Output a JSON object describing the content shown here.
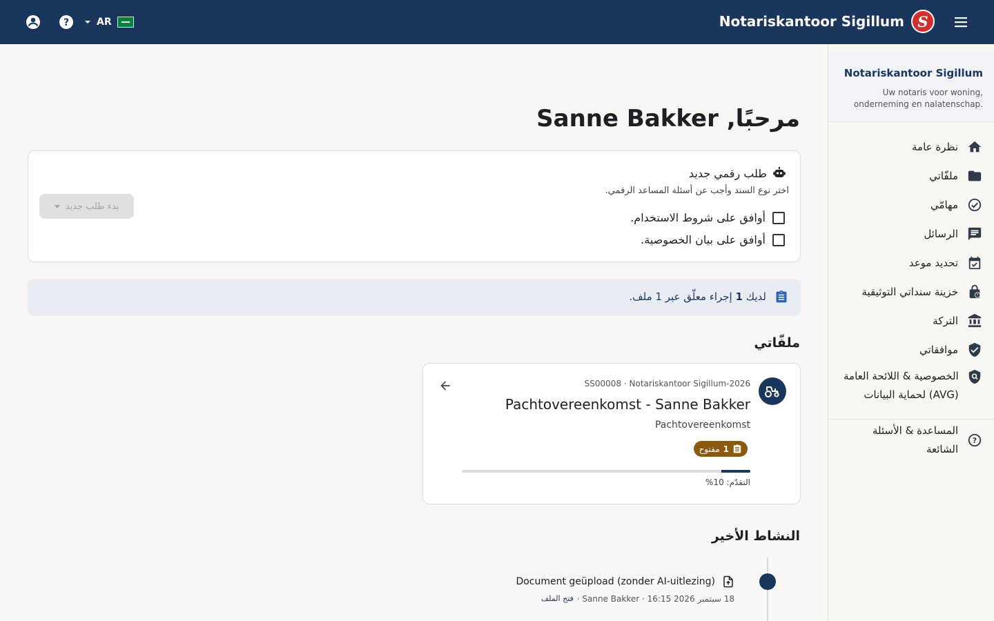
{
  "topbar": {
    "brand_name": "Notariskantoor Sigillum",
    "logo_letter": "S",
    "lang_code": "AR",
    "icons": [
      "account-circle-icon",
      "help-icon",
      "chevron-down-icon",
      "flag-icon",
      "menu-icon"
    ]
  },
  "sidebar": {
    "title": "Notariskantoor Sigillum",
    "subtitle": "Uw notaris voor woning, onderneming en nalatenschap.",
    "items": [
      {
        "label": "نظرة عامة",
        "icon": "home-icon"
      },
      {
        "label": "ملفّاتي",
        "icon": "folder-icon"
      },
      {
        "label": "مهامّي",
        "icon": "check-circle-icon"
      },
      {
        "label": "الرسائل",
        "icon": "chat-icon"
      },
      {
        "label": "تحديد موعد",
        "icon": "calendar-check-icon"
      },
      {
        "label": "خزينة سنداتي التوثيقية",
        "icon": "lock-icon"
      },
      {
        "label": "التركة",
        "icon": "bank-icon"
      },
      {
        "label": "موافقاتي",
        "icon": "shield-check-icon"
      },
      {
        "label": "الخصوصية & اللائحة العامة لحماية البيانات (AVG)",
        "icon": "privacy-shield-icon"
      }
    ],
    "help_item": {
      "label": "المساعدة & الأسئلة الشائعة",
      "icon": "help-outline-icon"
    }
  },
  "main": {
    "greeting": "مرحبًا, Sanne Bakker",
    "new_request": {
      "title": "طلب رقمي جديد",
      "subtitle": "اختر نوع السند وأجب عن أسئلة المساعد الرقمي.",
      "terms_label": "أوافق على شروط الاستخدام.",
      "privacy_label": "أوافق على بيان الخصوصية.",
      "start_button": "بدء طلب جديد"
    },
    "banner": {
      "prefix": "لديك",
      "count": "1",
      "suffix": "إجراء معلّق عبر 1 ملف."
    },
    "files_heading": "ملفّاتي",
    "dossier": {
      "meta": "SS00008 · Notariskantoor Sigillum-2026",
      "title": "Pachtovereenkomst - Sanne Bakker",
      "type": "Pachtovereenkomst",
      "badge_count": "1",
      "badge_label": "مفتوح",
      "progress": 0.1,
      "progress_label": "التقدّم: 10%"
    },
    "activity_heading": "النشاط الأخير",
    "activity": [
      {
        "title": "Document geüpload (zonder AI-uitlezing)",
        "meta": "18 سبتمبر 2026 16:15 · Sanne Bakker ·",
        "link": "فتح الملف"
      }
    ]
  },
  "colors": {
    "primary": "#1b365d",
    "badge": "#8c5a0f",
    "logo": "#d32f2f",
    "background": "#f8f7f5"
  }
}
